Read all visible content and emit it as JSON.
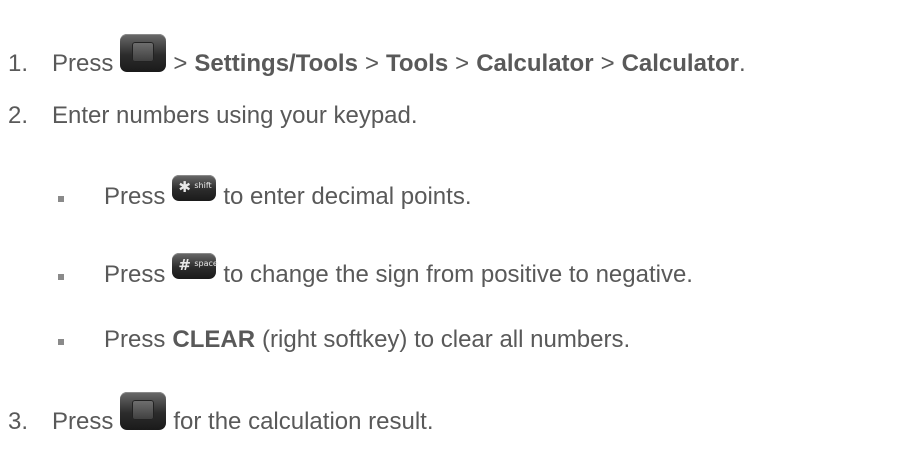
{
  "steps": [
    {
      "number": "1.",
      "press": "Press",
      "sep1": ">",
      "settings_tools": "Settings/Tools",
      "sep2": ">",
      "tools": "Tools",
      "sep3": ">",
      "calculator1": "Calculator",
      "sep4": ">",
      "calculator2": "Calculator",
      "end": ".",
      "icon": "center-menu-ok-key-icon"
    },
    {
      "number": "2.",
      "text": "Enter numbers using your keypad."
    },
    {
      "number": "3.",
      "press": "Press",
      "text": "for the calculation result.",
      "icon": "center-menu-ok-key-icon"
    }
  ],
  "bullets": [
    {
      "press": "Press",
      "text": "to enter decimal points.",
      "icon": "star-shift-key-icon",
      "key_glyph": "✱",
      "key_sub": "shift"
    },
    {
      "press": "Press",
      "text": "to change the sign from positive to negative.",
      "icon": "pound-space-key-icon",
      "key_glyph": "#",
      "key_sub": "space"
    },
    {
      "press": "Press",
      "clear": "CLEAR",
      "text": "(right softkey) to clear all numbers."
    }
  ]
}
